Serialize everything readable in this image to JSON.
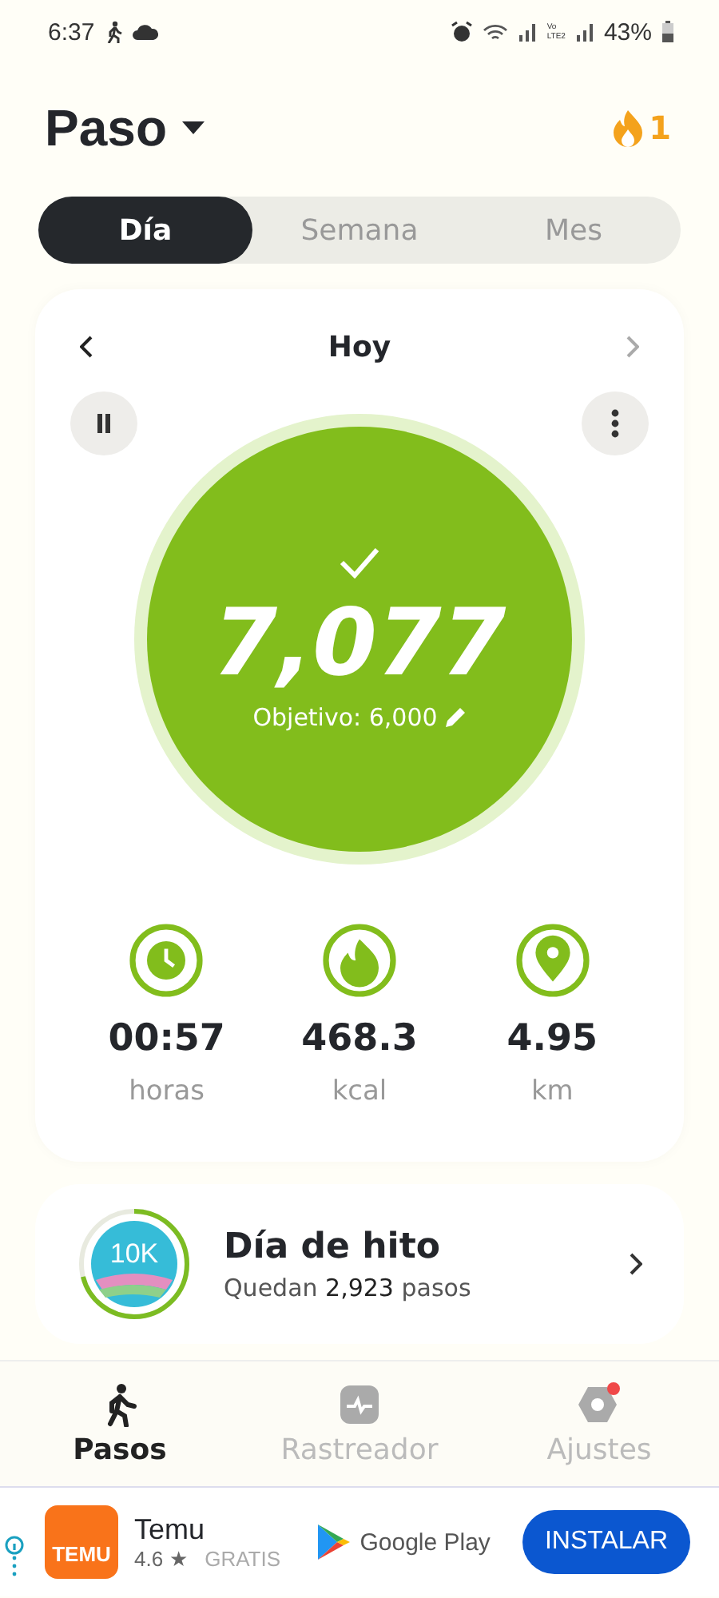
{
  "status_bar": {
    "time": "6:37",
    "volte_top": "Vo",
    "volte_bottom": "LTE2",
    "battery": "43%"
  },
  "header": {
    "title": "Paso",
    "streak": "1"
  },
  "tabs": [
    {
      "label": "Día",
      "selected": true
    },
    {
      "label": "Semana",
      "selected": false
    },
    {
      "label": "Mes",
      "selected": false
    }
  ],
  "day_card": {
    "date": "Hoy",
    "next_disabled": true,
    "steps": "7,077",
    "goal": "Objetivo: 6,000",
    "goal_reached": true,
    "stats": [
      {
        "kind": "time",
        "value": "00:57",
        "unit": "horas"
      },
      {
        "kind": "calories",
        "value": "468.3",
        "unit": "kcal"
      },
      {
        "kind": "distance",
        "value": "4.95",
        "unit": "km"
      }
    ]
  },
  "milestone": {
    "badge": "10K",
    "level": 0.71,
    "title": "Día de hito",
    "subtitle_prefix": "Quedan ",
    "remaining": "2,923",
    "subtitle_suffix": " pasos"
  },
  "bottom_nav": [
    {
      "kind": "steps",
      "label": "Pasos",
      "selected": true,
      "notification": false
    },
    {
      "kind": "tracker",
      "label": "Rastreador",
      "selected": false,
      "notification": false
    },
    {
      "kind": "settings",
      "label": "Ajustes",
      "selected": false,
      "notification": true
    }
  ],
  "ad": {
    "logo": "TEMU",
    "app": "Temu",
    "rating": "4.6",
    "star": "★",
    "price": "GRATIS",
    "store": "Google Play",
    "button": "INSTALAR"
  }
}
